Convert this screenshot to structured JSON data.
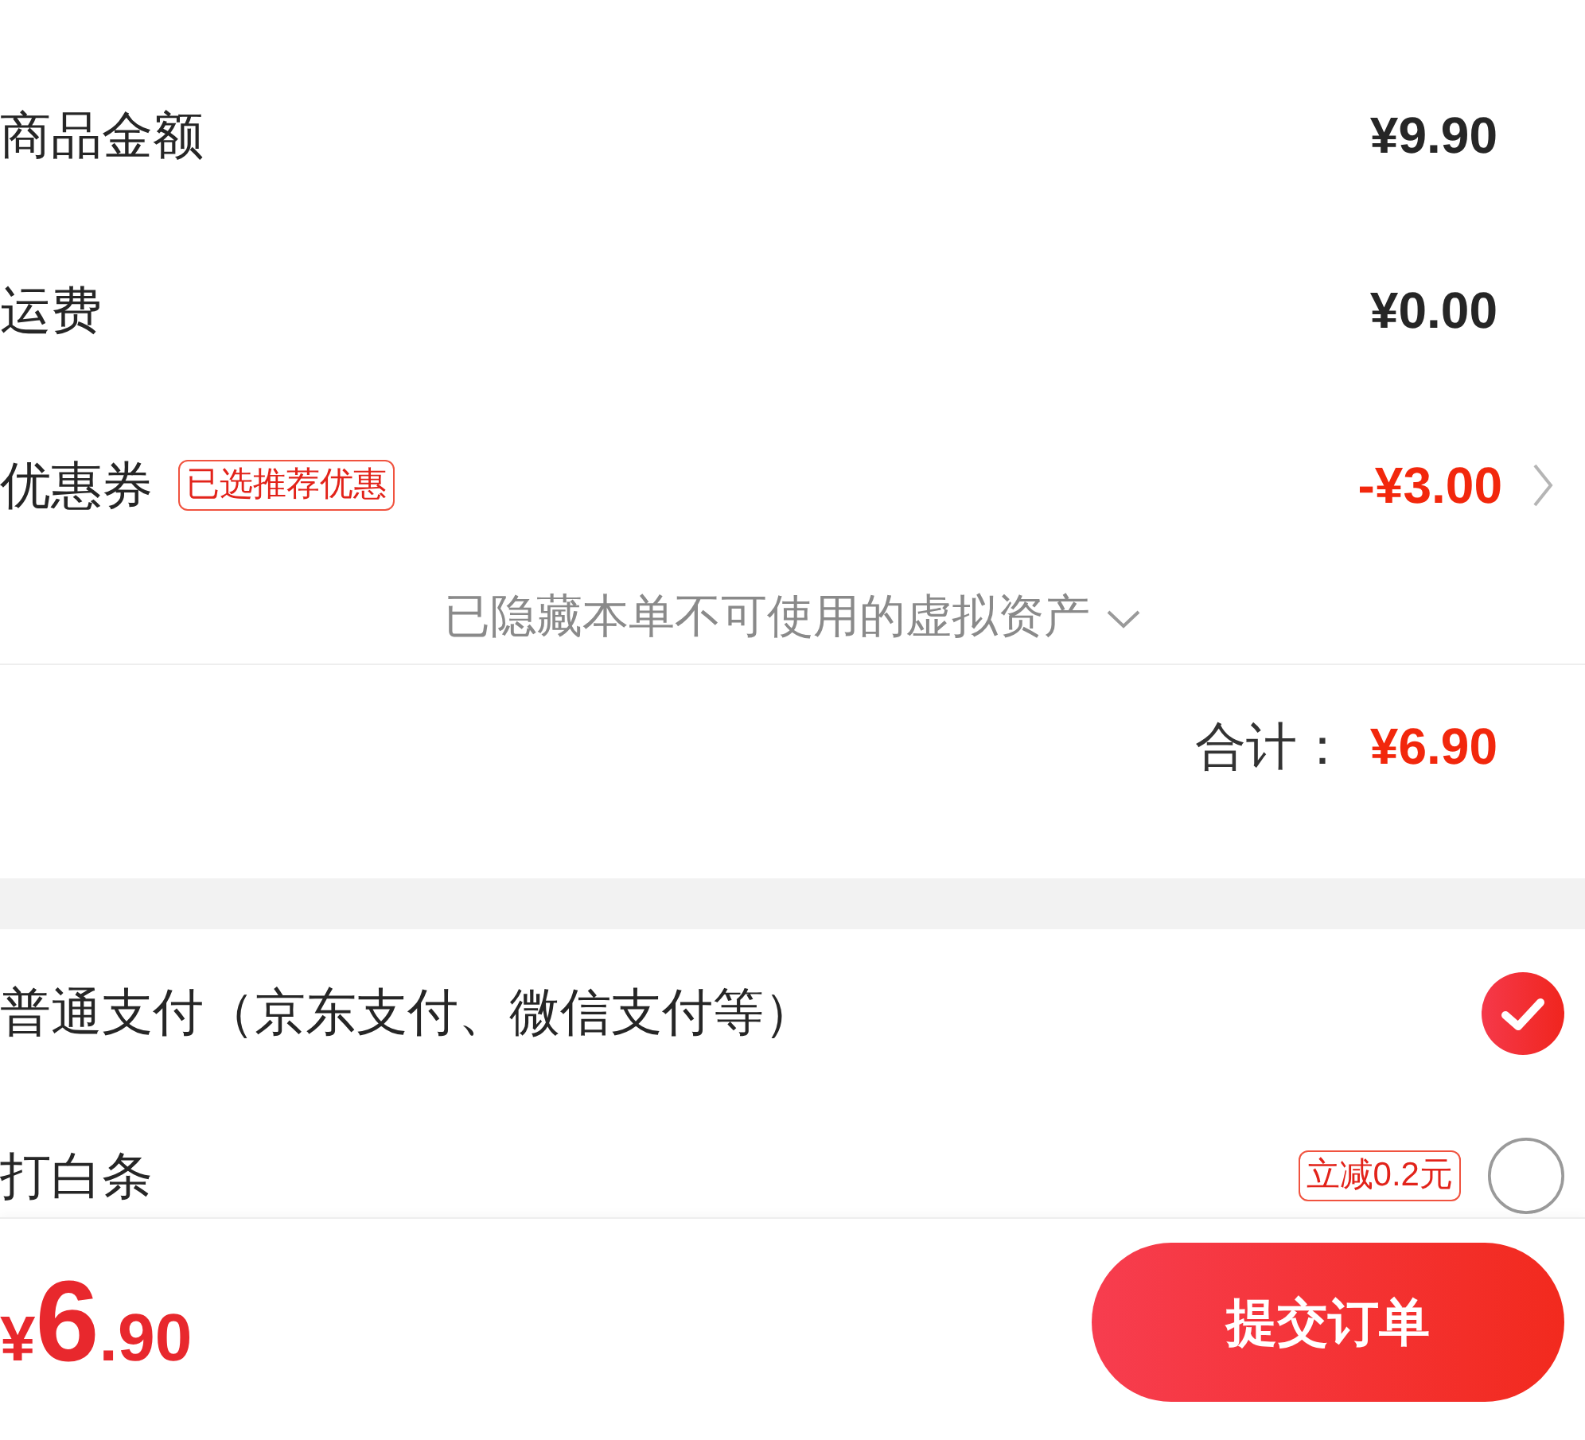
{
  "price_rows": [
    {
      "kind": "plain",
      "label": "商品金额",
      "value": "¥9.90"
    },
    {
      "kind": "plain",
      "label": "运费",
      "value": "¥0.00"
    },
    {
      "kind": "discount",
      "label": "优惠券",
      "tag": "已选推荐优惠",
      "value": "-¥3.00"
    }
  ],
  "hidden_notice": {
    "text": "已隐藏本单不可使用的虚拟资产"
  },
  "total": {
    "label": "合计：",
    "value": "¥6.90"
  },
  "payment_methods": [
    {
      "label": "普通支付（京东支付、微信支付等）",
      "selected": true
    },
    {
      "label": "打白条",
      "tag": "立减0.2元",
      "selected": false
    }
  ],
  "footer": {
    "price": {
      "currency": "¥",
      "integer": "6",
      "decimal": ".90"
    },
    "submit_button": "提交订单"
  }
}
